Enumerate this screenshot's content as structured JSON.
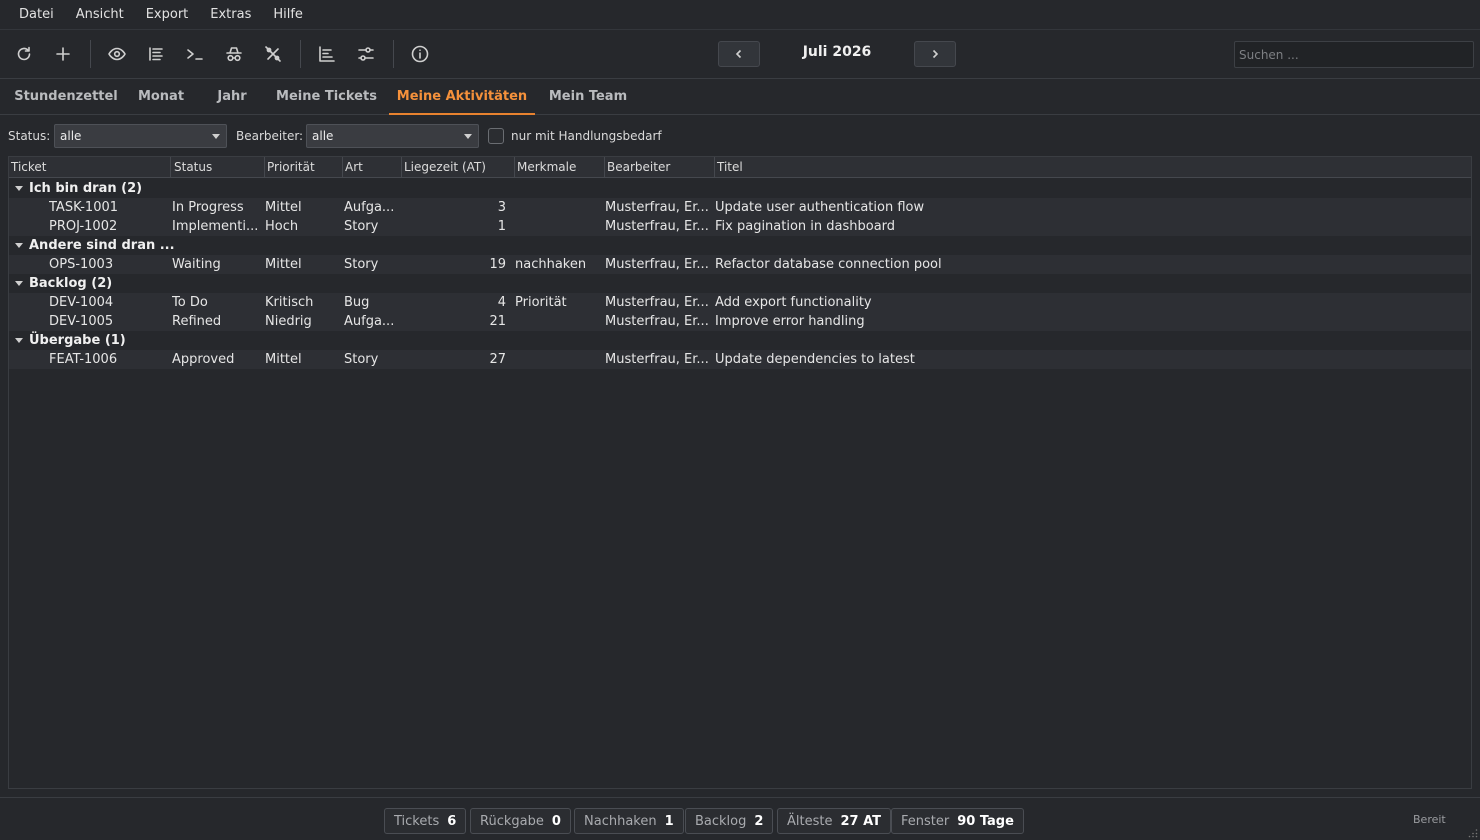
{
  "menu": [
    "Datei",
    "Ansicht",
    "Export",
    "Extras",
    "Hilfe"
  ],
  "toolbar": {
    "icons": [
      "refresh-icon",
      "plus-icon",
      "eye-icon",
      "list-icon",
      "terminal-icon",
      "incognito-icon",
      "percent-off-icon",
      "align-left-icon",
      "sliders-icon",
      "info-icon"
    ],
    "month": "Juli 2026",
    "search_placeholder": "Suchen ..."
  },
  "tabs": [
    {
      "label": "Stundenzettel",
      "active": false
    },
    {
      "label": "Monat",
      "active": false
    },
    {
      "label": "Jahr",
      "active": false
    },
    {
      "label": "Meine Tickets",
      "active": false
    },
    {
      "label": "Meine Aktivitäten",
      "active": true
    },
    {
      "label": "Mein Team",
      "active": false
    }
  ],
  "filters": {
    "status_label": "Status:",
    "status_value": "alle",
    "assignee_label": "Bearbeiter:",
    "assignee_value": "alle",
    "checkbox_label": "nur mit Handlungsbedarf",
    "checkbox_checked": false
  },
  "table": {
    "columns": [
      "Ticket",
      "Status",
      "Priorität",
      "Art",
      "Liegezeit (AT)",
      "Merkmale",
      "Bearbeiter",
      "Titel"
    ],
    "groups": [
      {
        "title": "Ich bin dran  (2)",
        "rows": [
          [
            "TASK-1001",
            "In Progress",
            "Mittel",
            "Aufga...",
            "3",
            "",
            "Musterfrau, Er...",
            "Update user authentication flow"
          ],
          [
            "PROJ-1002",
            "Implementi...",
            "Hoch",
            "Story",
            "1",
            "",
            "Musterfrau, Er...",
            "Fix pagination in dashboard"
          ]
        ]
      },
      {
        "title": "Andere sind dran ...",
        "rows": [
          [
            "OPS-1003",
            "Waiting",
            "Mittel",
            "Story",
            "19",
            "nachhaken",
            "Musterfrau, Er...",
            "Refactor database connection pool"
          ]
        ]
      },
      {
        "title": "Backlog  (2)",
        "rows": [
          [
            "DEV-1004",
            "To Do",
            "Kritisch",
            "Bug",
            "4",
            "Priorität",
            "Musterfrau, Er...",
            "Add export functionality"
          ],
          [
            "DEV-1005",
            "Refined",
            "Niedrig",
            "Aufga...",
            "21",
            "",
            "Musterfrau, Er...",
            "Improve error handling"
          ]
        ]
      },
      {
        "title": "Übergabe  (1)",
        "rows": [
          [
            "FEAT-1006",
            "Approved",
            "Mittel",
            "Story",
            "27",
            "",
            "Musterfrau, Er...",
            "Update dependencies to latest"
          ]
        ]
      }
    ]
  },
  "statusbar": {
    "chips": [
      {
        "label": "Tickets",
        "value": "6"
      },
      {
        "label": "Rückgabe",
        "value": "0"
      },
      {
        "label": "Nachhaken",
        "value": "1"
      },
      {
        "label": "Backlog",
        "value": "2"
      },
      {
        "label": "Älteste",
        "value": "27 AT"
      },
      {
        "label": "Fenster",
        "value": "90 Tage"
      }
    ],
    "status_text": "Bereit"
  },
  "colors": {
    "accent": "#f5913b",
    "background": "#26282c",
    "row": "#2d2f34"
  }
}
